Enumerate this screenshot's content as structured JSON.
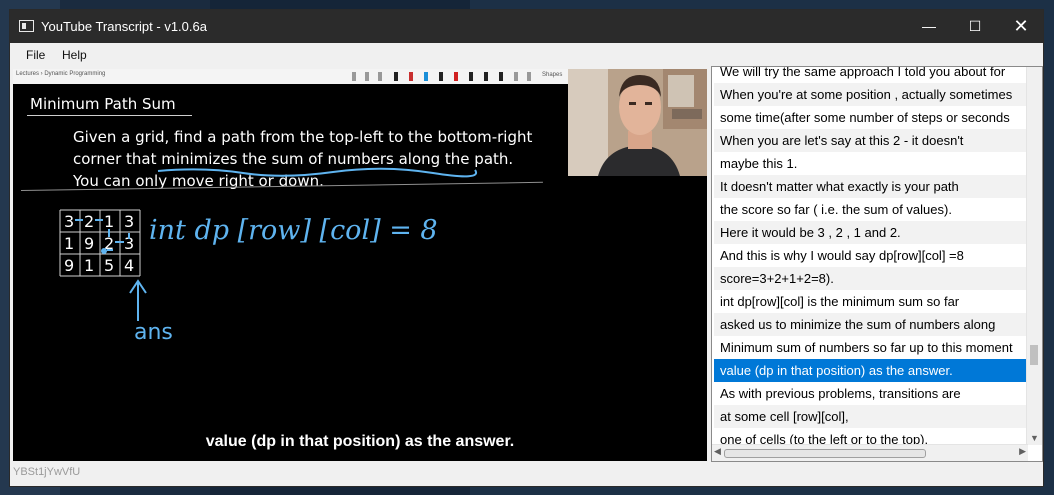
{
  "window": {
    "title": "YouTube Transcript - v1.0.6a",
    "controls": {
      "minimize": "—",
      "maximize": "☐",
      "close": "✕"
    }
  },
  "menu": [
    "File",
    "Help"
  ],
  "video": {
    "breadcrumb": "Lectures › Dynamic Programming",
    "toolbar_shapes": "Shapes",
    "lecture_title": "Minimum Path Sum",
    "problem_lines": [
      "Given a grid, find a path from the top-left to the bottom-right",
      "corner that minimizes the sum of numbers along the path.",
      "You can only move right or down."
    ],
    "grid": [
      [
        "3",
        "2",
        "1",
        "3"
      ],
      [
        "1",
        "9",
        "2",
        "3"
      ],
      [
        "9",
        "1",
        "5",
        "4"
      ]
    ],
    "formula": "int dp [row] [col] = 8",
    "annotation": "ans",
    "caption": "value (dp in that position) as the answer.",
    "ink_color": "#5fb4f0"
  },
  "transcript": {
    "selected_index": 13,
    "selected_color": "#0078d7",
    "lines": [
      "We will try the same approach I told you about for",
      "When you're at some position , actually sometimes",
      "some time(after some number of steps or seconds",
      "When you are let's say at this 2 - it doesn't",
      "maybe this 1.",
      "It doesn't matter what exactly is your path",
      "the score so far ( i.e. the sum of values).",
      "Here it would be 3 , 2 , 1 and 2.",
      "And this is why I would say dp[row][col] =8",
      "score=3+2+1+2=8).",
      "int dp[row][col] is the minimum sum so far",
      "asked us to minimize the sum of numbers along",
      "Minimum sum of numbers so far up to this moment",
      "value (dp in that position) as the answer.",
      "As with previous problems, transitions are",
      "at some cell [row][col],",
      "one of cells (to the left or to the top)."
    ]
  },
  "status": {
    "video_id": "YBSt1jYwVfU"
  }
}
